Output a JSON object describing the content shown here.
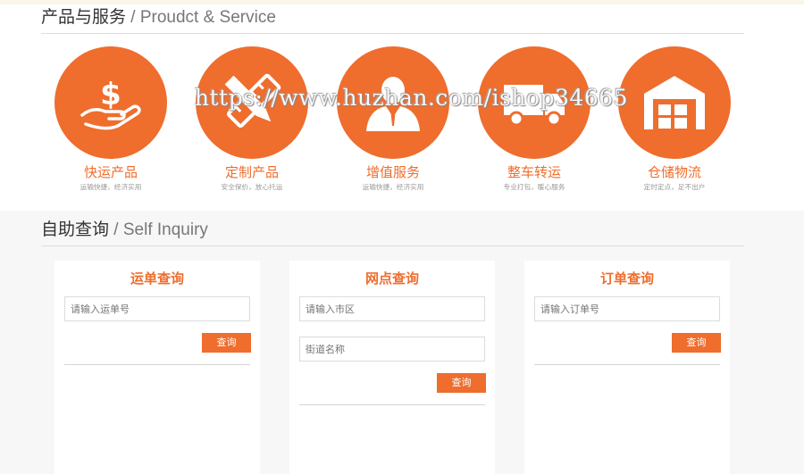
{
  "services_section": {
    "title_zh": "产品与服务",
    "title_en": " / Proudct & Service",
    "items": [
      {
        "title": "快运产品",
        "desc": "运输快捷，经济实用",
        "icon": "money-hand-icon"
      },
      {
        "title": "定制产品",
        "desc": "安全保价，放心托运",
        "icon": "pencil-ruler-icon"
      },
      {
        "title": "增值服务",
        "desc": "运输快捷，经济实用",
        "icon": "service-person-icon"
      },
      {
        "title": "整车转运",
        "desc": "专业打包，暖心服务",
        "icon": "truck-icon"
      },
      {
        "title": "仓储物流",
        "desc": "定时定点，足不出户",
        "icon": "warehouse-icon"
      }
    ],
    "watermark": "https://www.huzhan.com/ishop34665"
  },
  "inquiry_section": {
    "title_zh": "自助查询",
    "title_en": " / Self Inquiry",
    "waybill": {
      "title": "运单查询",
      "placeholder": "请输入运单号",
      "button": "查询"
    },
    "outlet": {
      "title": "网点查询",
      "city_placeholder": "请输入市区",
      "street_placeholder": "街道名称",
      "button": "查询"
    },
    "order": {
      "title": "订单查询",
      "placeholder": "请输入订单号",
      "button": "查询"
    }
  },
  "colors": {
    "accent": "#ef6d2d",
    "background": "#f7f7f7",
    "card": "#ffffff"
  }
}
